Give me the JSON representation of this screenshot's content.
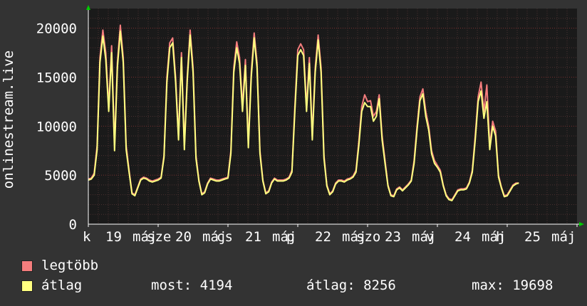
{
  "chart_data": {
    "type": "line",
    "ylabel": "onlinestream.live",
    "ylim": [
      0,
      22000
    ],
    "yticks": [
      0,
      5000,
      10000,
      15000,
      20000
    ],
    "xtick_labels": [
      "k",
      "19",
      "máj",
      "sze",
      "20",
      "máj",
      "cs",
      "21",
      "máj",
      "p",
      "22",
      "máj",
      "szo",
      "23",
      "máj",
      "v",
      "24",
      "máj",
      "h",
      "25",
      "máj"
    ],
    "days": 6.5,
    "grid": true,
    "series": [
      {
        "name": "legtöbb",
        "color": "#f47d7d",
        "samples_per_day": 24,
        "values": [
          4600,
          4700,
          5200,
          8000,
          17000,
          19800,
          17500,
          12000,
          18200,
          8000,
          16500,
          20300,
          17000,
          8000,
          5500,
          3200,
          3000,
          3800,
          4600,
          4800,
          4700,
          4500,
          4400,
          4500,
          4600,
          4800,
          7000,
          15000,
          18500,
          19000,
          15000,
          9000,
          17500,
          8000,
          15000,
          19800,
          16000,
          7000,
          4500,
          3100,
          3300,
          4200,
          4700,
          4600,
          4500,
          4500,
          4600,
          4700,
          4800,
          7500,
          16000,
          18600,
          17000,
          12000,
          16800,
          8200,
          15500,
          19500,
          16500,
          7500,
          4500,
          3200,
          3400,
          4300,
          4700,
          4500,
          4500,
          4500,
          4600,
          4800,
          5500,
          12000,
          17800,
          18400,
          17800,
          12000,
          17000,
          9000,
          16000,
          19300,
          16000,
          7000,
          4000,
          3100,
          3400,
          4200,
          4500,
          4500,
          4400,
          4600,
          4700,
          4900,
          5500,
          8500,
          12000,
          13200,
          12500,
          12600,
          11000,
          11500,
          13200,
          9000,
          6500,
          4000,
          3000,
          2900,
          3600,
          3800,
          3500,
          3800,
          4100,
          4500,
          6500,
          10000,
          13000,
          13800,
          11500,
          10000,
          7500,
          6500,
          6000,
          5500,
          4000,
          3000,
          2600,
          2500,
          3000,
          3500,
          3600,
          3600,
          3700,
          4300,
          5500,
          9000,
          13000,
          14500,
          11500,
          14200,
          8000,
          10500,
          9500,
          5000,
          3800,
          2900,
          3000,
          3500,
          4000,
          4200,
          4194
        ]
      },
      {
        "name": "átlag",
        "color": "#ffff80",
        "samples_per_day": 24,
        "values": [
          4500,
          4600,
          5000,
          7600,
          16500,
          19200,
          16800,
          11500,
          17500,
          7500,
          16000,
          19700,
          16500,
          7600,
          5300,
          3100,
          2900,
          3700,
          4500,
          4700,
          4600,
          4400,
          4300,
          4400,
          4500,
          4700,
          6800,
          14500,
          18000,
          18500,
          14500,
          8600,
          17000,
          7600,
          14600,
          19300,
          15500,
          6700,
          4400,
          3000,
          3200,
          4100,
          4600,
          4500,
          4400,
          4400,
          4500,
          4600,
          4700,
          7200,
          15500,
          18000,
          16400,
          11500,
          16200,
          7800,
          15000,
          19000,
          16000,
          7200,
          4400,
          3100,
          3300,
          4200,
          4600,
          4400,
          4400,
          4400,
          4500,
          4700,
          5300,
          11500,
          17200,
          17800,
          17200,
          11500,
          16400,
          8600,
          15500,
          18800,
          15500,
          6700,
          3900,
          3000,
          3300,
          4100,
          4400,
          4400,
          4300,
          4500,
          4600,
          4800,
          5300,
          8100,
          11500,
          12400,
          12000,
          12000,
          10500,
          11000,
          12800,
          8600,
          6200,
          3900,
          2900,
          2800,
          3500,
          3700,
          3400,
          3700,
          4000,
          4400,
          6200,
          9600,
          12600,
          13300,
          11000,
          9600,
          7200,
          6200,
          5800,
          5300,
          3900,
          2900,
          2500,
          2400,
          2900,
          3400,
          3500,
          3500,
          3600,
          4200,
          5300,
          8600,
          12500,
          13600,
          10800,
          12500,
          7600,
          10000,
          9000,
          4800,
          3700,
          2800,
          2900,
          3400,
          3900,
          4100,
          4194
        ]
      }
    ]
  },
  "legend": {
    "max_label": "legtöbb",
    "avg_label": "átlag",
    "max_color": "#f47d7d",
    "avg_color": "#ffff80",
    "now_text": "most: 4194",
    "avg_text": "átlag: 8256",
    "max_text": "max: 19698"
  }
}
